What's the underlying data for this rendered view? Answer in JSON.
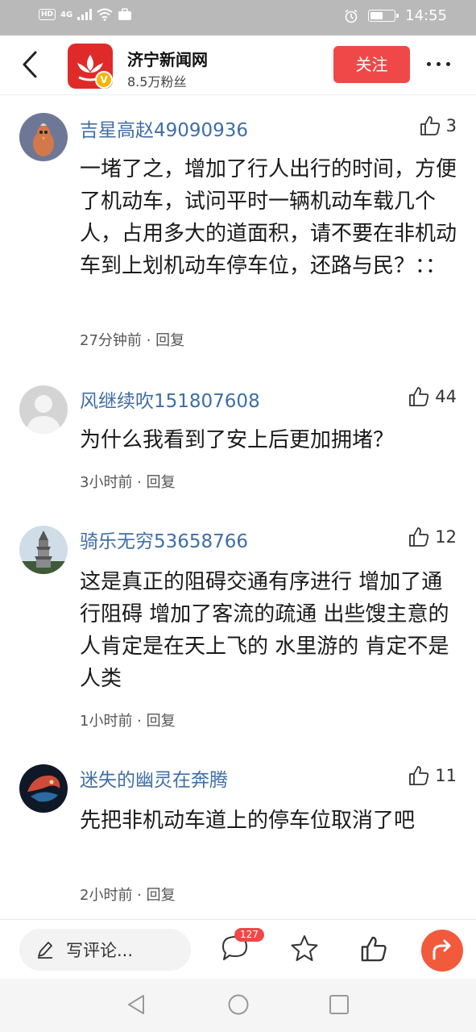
{
  "status_bar": {
    "network": "4G",
    "hd": "HD",
    "time": "14:55",
    "battery_level": 0.55
  },
  "header": {
    "site_name": "济宁新闻网",
    "followers": "8.5万粉丝",
    "follow_label": "关注",
    "verified_badge": "V",
    "icons": {
      "back": "back-arrow-icon",
      "more": "more-dots-icon",
      "logo": "jining-news-logo"
    }
  },
  "comments": [
    {
      "user": "吉星高赵49090936",
      "likes": "3",
      "text": "一堵了之，增加了行人出行的时间，方便了机动车，试问平时一辆机动车载几个人，占用多大的道面积，请不要在非机动车到上划机动车停车位，还路与民？：：",
      "time": "27分钟前",
      "separator": " · ",
      "reply": "回复"
    },
    {
      "user": "风继续吹151807608",
      "likes": "44",
      "text": "为什么我看到了安上后更加拥堵？",
      "time": "3小时前",
      "separator": " · ",
      "reply": "回复"
    },
    {
      "user": "骑乐无穷53658766",
      "likes": "12",
      "text": "这是真正的阻碍交通有序进行 增加了通行阻碍 增加了客流的疏通 出些馊主意的人肯定是在天上飞的 水里游的 肯定不是人类",
      "time": "1小时前",
      "separator": " · ",
      "reply": "回复"
    },
    {
      "user": "迷失的幽灵在奔腾",
      "likes": "11",
      "text": "先把非机动车道上的停车位取消了吧",
      "time": "2小时前",
      "separator": " · ",
      "reply": "回复"
    }
  ],
  "bottom_bar": {
    "write_placeholder": "写评论...",
    "comment_count": "127",
    "icons": [
      "pen-icon",
      "comment-bubble-icon",
      "star-icon",
      "thumbs-up-icon",
      "share-arrow-icon"
    ]
  },
  "nav_bar": {
    "icons": [
      "nav-back-icon",
      "nav-home-icon",
      "nav-recents-icon"
    ]
  },
  "colors": {
    "accent_red": "#f04848",
    "username_blue": "#3f6ea5",
    "status_bar_gray": "#b9b9b9",
    "share_orange": "#f25a3c"
  }
}
